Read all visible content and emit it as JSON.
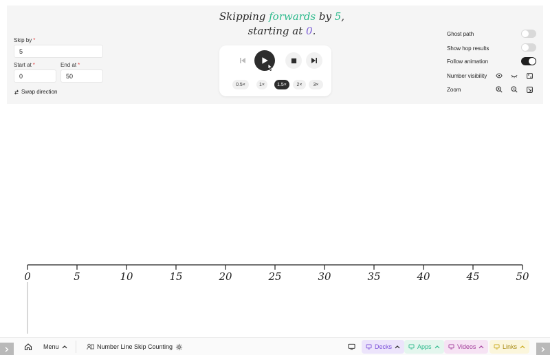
{
  "headline": {
    "line1_prefix": "Skipping ",
    "direction": "forwards",
    "line1_mid": " by ",
    "skip_value": "5",
    "line1_suffix": ",",
    "line2_prefix": "starting at ",
    "start_value": "0",
    "line2_suffix": "."
  },
  "fields": {
    "skip_by": {
      "label": "Skip by",
      "required_mark": "*",
      "value": "5"
    },
    "start_at": {
      "label": "Start at",
      "required_mark": "*",
      "value": "0"
    },
    "end_at": {
      "label": "End at",
      "required_mark": "*",
      "value": "50"
    }
  },
  "swap_direction_label": "Swap direction",
  "player": {
    "speeds": [
      "0.5×",
      "1×",
      "1.5×",
      "2×",
      "3×"
    ],
    "active_speed": "1.5×"
  },
  "settings": {
    "ghost_path": {
      "label": "Ghost path",
      "on": false
    },
    "show_hop_results": {
      "label": "Show hop results",
      "on": false
    },
    "follow_animation": {
      "label": "Follow animation",
      "on": true
    },
    "number_visibility": {
      "label": "Number visibility"
    },
    "zoom": {
      "label": "Zoom"
    }
  },
  "number_line": {
    "start": 0,
    "end": 50,
    "step": 5,
    "labels": [
      "0",
      "5",
      "10",
      "15",
      "20",
      "25",
      "30",
      "35",
      "40",
      "45",
      "50"
    ]
  },
  "bottom_bar": {
    "menu_label": "Menu",
    "activity_title": "Number Line Skip Counting",
    "decks_label": "Decks",
    "apps_label": "Apps",
    "videos_label": "Videos",
    "links_label": "Links"
  },
  "colors": {
    "accent_green": "#2bb98b",
    "accent_purple": "#7a5cd6",
    "decks_bg": "#ece4fb",
    "decks_fg": "#7b4fd9",
    "apps_bg": "#e4f6ee",
    "apps_fg": "#2bb98b",
    "videos_bg": "#f6e3f4",
    "videos_fg": "#a23b9a",
    "links_bg": "#fbf6dc",
    "links_fg": "#a88b12"
  }
}
